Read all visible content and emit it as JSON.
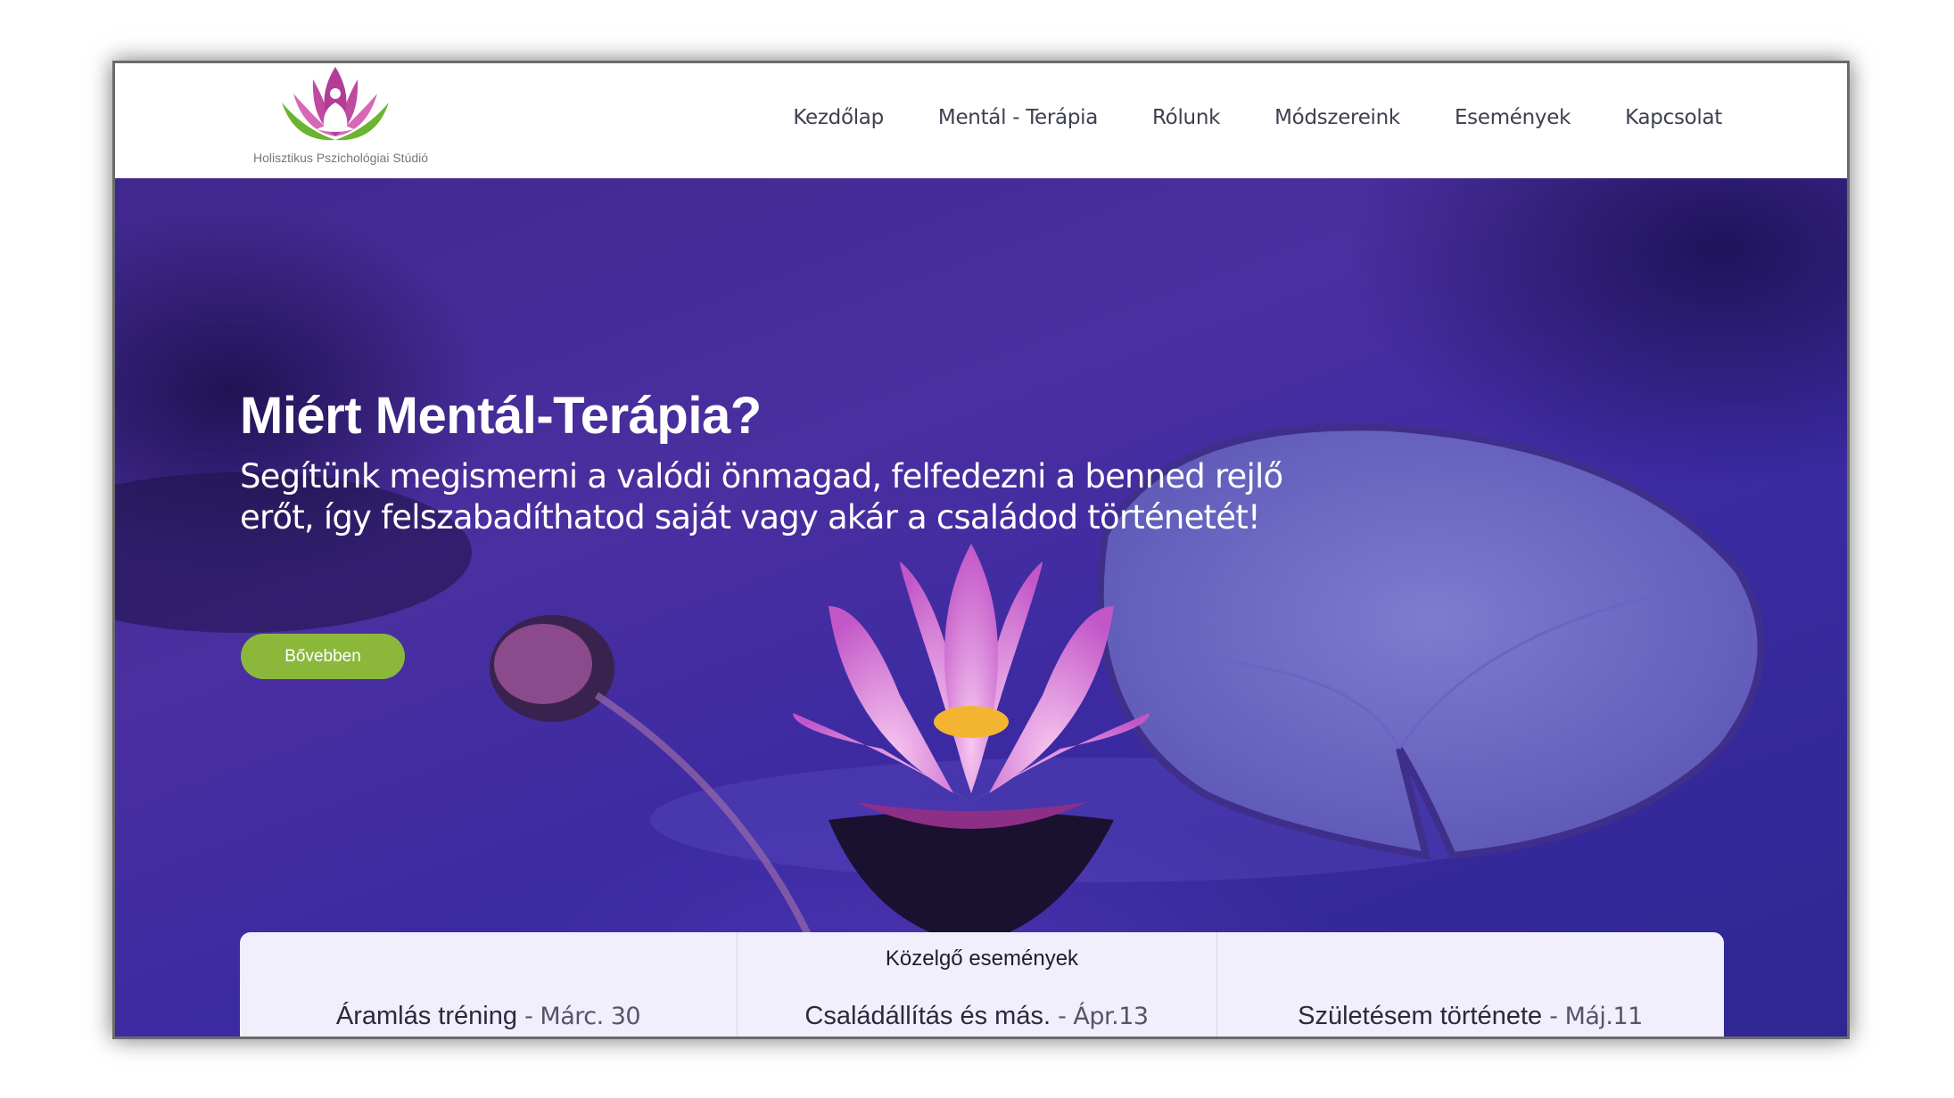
{
  "brand": {
    "name": "Holisztikus Pszichológiai Stúdió"
  },
  "nav": {
    "items": [
      "Kezdőlap",
      "Mentál - Terápia",
      "Rólunk",
      "Módszereink",
      "Események",
      "Kapcsolat"
    ]
  },
  "hero": {
    "title": "Miért Mentál-Terápia?",
    "subtitle": "Segítünk megismerni a valódi önmagad, felfedezni a benned rejlő erőt, így felszabadíthatod saját vagy akár a családod történetét!",
    "button_label": "Bővebben"
  },
  "events": {
    "title": "Közelgő események",
    "items": [
      {
        "name": "Áramlás tréning",
        "date": " - Márc. 30"
      },
      {
        "name": "Családállítás és más.",
        "date": " - Ápr.13"
      },
      {
        "name": "Születésem története",
        "date": " - Máj.11"
      }
    ]
  },
  "colors": {
    "accent_green": "#8bb83b",
    "hero_purple": "#4a2fa0",
    "panel_bg": "#f1effc"
  }
}
